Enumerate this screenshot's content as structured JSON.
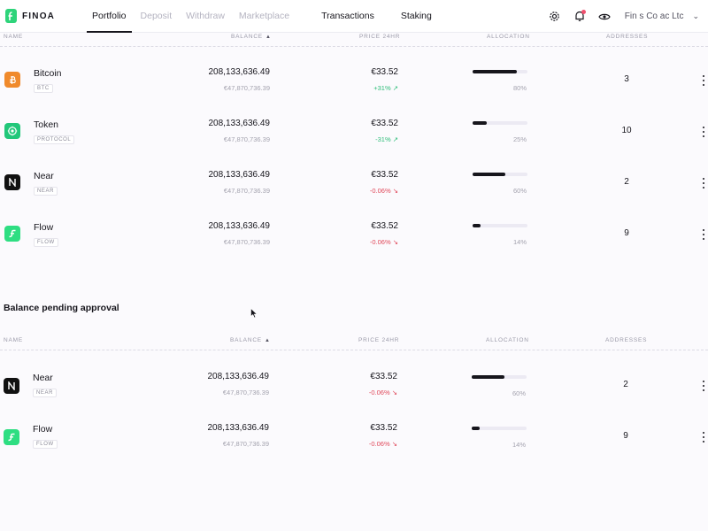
{
  "brand": {
    "name": "FINOA"
  },
  "nav": {
    "tabs": [
      {
        "label": "Portfolio",
        "state": "active"
      },
      {
        "label": "Deposit",
        "state": "muted"
      },
      {
        "label": "Withdraw",
        "state": "muted"
      },
      {
        "label": "Marketplace",
        "state": "muted"
      },
      {
        "label": "Transactions",
        "state": "dark"
      },
      {
        "label": "Staking",
        "state": "dark"
      }
    ],
    "icons": [
      "settings-icon",
      "notification-bell-icon",
      "eye-icon"
    ],
    "account": {
      "name": "Fin s Co  ac  Ltc",
      "chevron": "⌄"
    }
  },
  "columns": {
    "name": "NAME",
    "balance": "BALANCE",
    "balance_sort": "▲",
    "price": "PRICE 24HR",
    "allocation": "ALLOCATION",
    "addresses": "ADDRESSES"
  },
  "colors": {
    "bitcoin": "#f08a2c",
    "token": "#22c77a",
    "near": "#111111",
    "flow": "#2ede82",
    "positive": "#2ebd79",
    "negative": "#e0485a"
  },
  "portfolio": {
    "rows": [
      {
        "name": "Bitcoin",
        "ticker": "BTC",
        "icon": "bitcoin-icon",
        "balance": "208,133,636.49",
        "balance_eur": "€47,870,736.39",
        "price": "€33.52",
        "change": "+31% ↗",
        "direction": "up",
        "allocation_pct": 80,
        "allocation_label": "80%",
        "addresses": "3"
      },
      {
        "name": "Token",
        "ticker": "PROTOCOL",
        "icon": "token-icon",
        "balance": "208,133,636.49",
        "balance_eur": "€47,870,736.39",
        "price": "€33.52",
        "change": "-31% ↗",
        "direction": "up",
        "allocation_pct": 25,
        "allocation_label": "25%",
        "addresses": "10"
      },
      {
        "name": "Near",
        "ticker": "NEAR",
        "icon": "near-icon",
        "balance": "208,133,636.49",
        "balance_eur": "€47,870,736.39",
        "price": "€33.52",
        "change": "-0.06% ↘",
        "direction": "down",
        "allocation_pct": 60,
        "allocation_label": "60%",
        "addresses": "2"
      },
      {
        "name": "Flow",
        "ticker": "FLOW",
        "icon": "flow-icon",
        "balance": "208,133,636.49",
        "balance_eur": "€47,870,736.39",
        "price": "€33.52",
        "change": "-0.06% ↘",
        "direction": "down",
        "allocation_pct": 14,
        "allocation_label": "14%",
        "addresses": "9"
      }
    ]
  },
  "pending": {
    "title": "Balance pending approval",
    "rows": [
      {
        "name": "Near",
        "ticker": "NEAR",
        "icon": "near-icon",
        "balance": "208,133,636.49",
        "balance_eur": "€47,870,736.39",
        "price": "€33.52",
        "change": "-0.06% ↘",
        "direction": "down",
        "allocation_pct": 60,
        "allocation_label": "60%",
        "addresses": "2"
      },
      {
        "name": "Flow",
        "ticker": "FLOW",
        "icon": "flow-icon",
        "balance": "208,133,636.49",
        "balance_eur": "€47,870,736.39",
        "price": "€33.52",
        "change": "-0.06% ↘",
        "direction": "down",
        "allocation_pct": 14,
        "allocation_label": "14%",
        "addresses": "9"
      }
    ]
  }
}
